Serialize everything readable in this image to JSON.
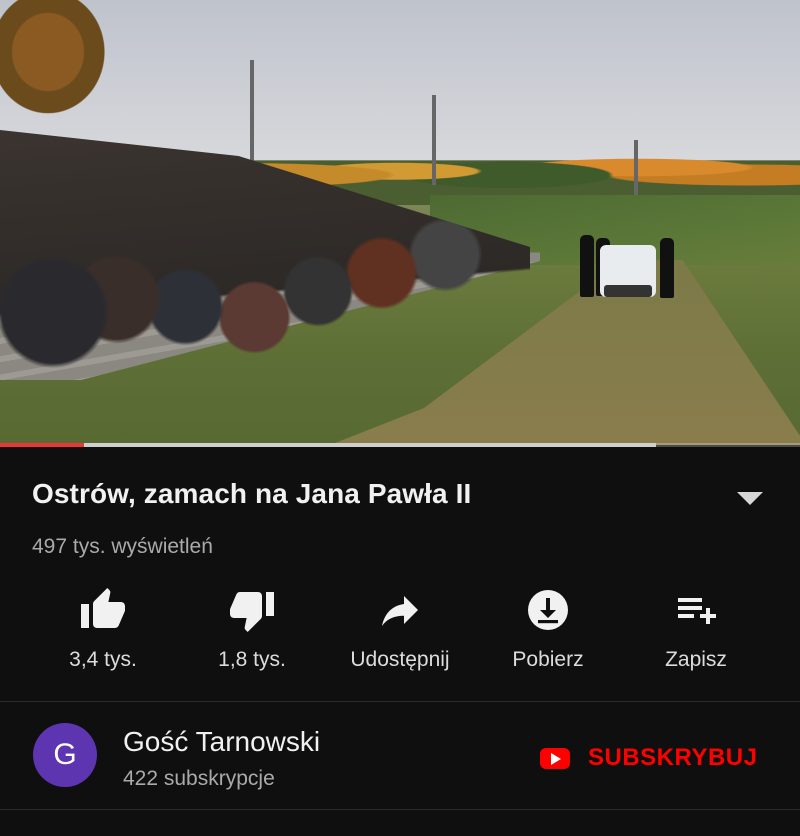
{
  "video": {
    "progress": {
      "played_fraction": 0.105,
      "buffered_fraction": 0.82
    }
  },
  "info": {
    "title": "Ostrów, zamach na Jana Pawła II",
    "views": "497 tys. wyświetleń"
  },
  "actions": [
    {
      "name": "like",
      "label": "3,4 tys.",
      "icon": "thumbs-up-icon"
    },
    {
      "name": "dislike",
      "label": "1,8 tys.",
      "icon": "thumbs-down-icon"
    },
    {
      "name": "share",
      "label": "Udostępnij",
      "icon": "share-icon"
    },
    {
      "name": "download",
      "label": "Pobierz",
      "icon": "download-icon"
    },
    {
      "name": "save",
      "label": "Zapisz",
      "icon": "playlist-add-icon"
    }
  ],
  "channel": {
    "avatar_letter": "G",
    "avatar_color": "#5e35b1",
    "name": "Gość Tarnowski",
    "subscribers": "422 subskrypcje",
    "subscribe_label": "SUBSKRYBUJ",
    "accent": "#ff0000"
  }
}
